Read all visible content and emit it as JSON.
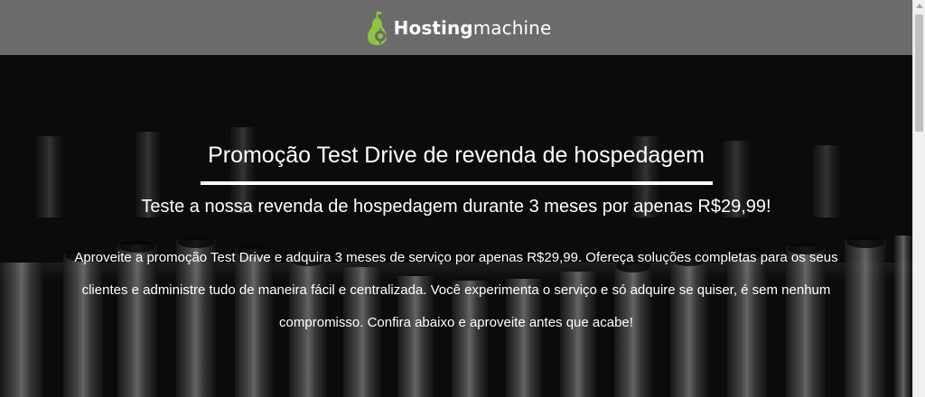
{
  "header": {
    "logo_bold": "Hosting",
    "logo_light": "machine",
    "logo_icon": "pear-gear-logo",
    "background": "#6b6b6b",
    "logo_accent": "#8cc63f"
  },
  "hero": {
    "title": "Promoção Test Drive de revenda de hospedagem",
    "subtitle": "Teste a nossa revenda de hospedagem durante 3 meses por apenas R$29,99!",
    "body": "Aproveite a promoção Test Drive e adquira 3 meses de serviço por apenas R$29,99. Ofereça soluções completas para os seus clientes e administre tudo de maneira fácil e centralizada. Você experimenta o serviço e só adquire se quiser, é sem nenhum compromisso. Confira abaixo e aproveite antes que acabe!",
    "background_image": "socket-wrench-set-photo"
  },
  "scrollbar": {
    "icon": "scroll-up-arrow-icon"
  }
}
